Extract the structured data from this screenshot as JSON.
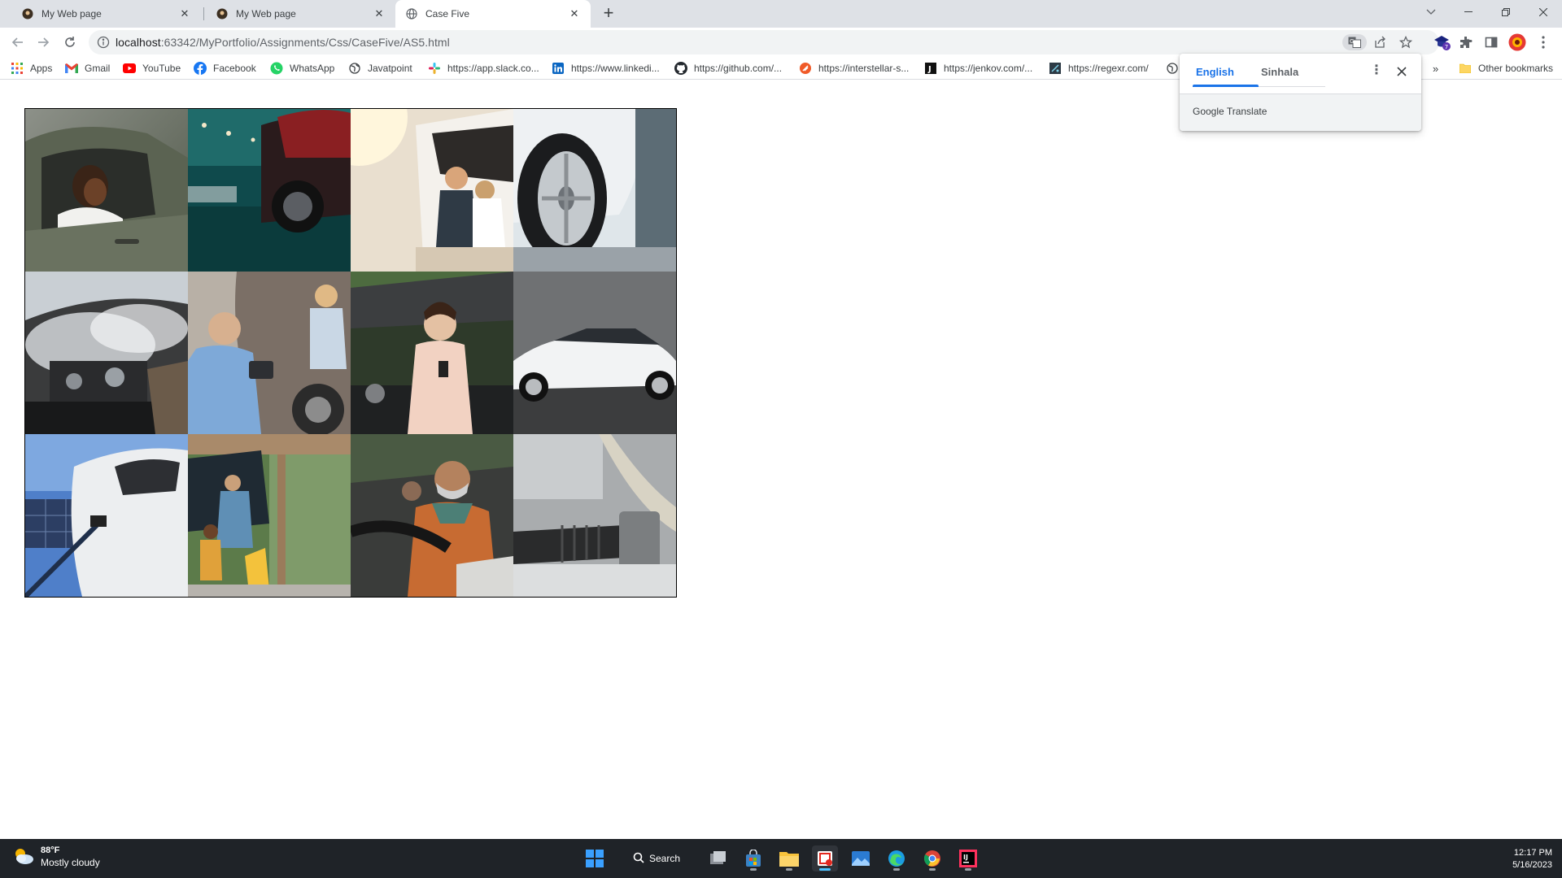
{
  "browser": {
    "tabs": [
      {
        "title": "My Web page",
        "active": false
      },
      {
        "title": "My Web page",
        "active": false
      },
      {
        "title": "Case Five",
        "active": true
      }
    ],
    "url_host": "localhost",
    "url_path": ":63342/MyPortfolio/Assignments/Css/CaseFive/AS5.html"
  },
  "bookmarks": [
    {
      "label": "Apps",
      "icon": "apps-grid-icon"
    },
    {
      "label": "Gmail",
      "icon": "gmail-icon"
    },
    {
      "label": "YouTube",
      "icon": "youtube-icon"
    },
    {
      "label": "Facebook",
      "icon": "facebook-icon"
    },
    {
      "label": "WhatsApp",
      "icon": "whatsapp-icon"
    },
    {
      "label": "Javatpoint",
      "icon": "globe-icon"
    },
    {
      "label": "https://app.slack.co...",
      "icon": "slack-icon"
    },
    {
      "label": "https://www.linkedi...",
      "icon": "linkedin-icon"
    },
    {
      "label": "https://github.com/...",
      "icon": "github-icon"
    },
    {
      "label": "https://interstellar-s...",
      "icon": "interstellar-icon"
    },
    {
      "label": "https://jenkov.com/...",
      "icon": "jenkov-icon"
    },
    {
      "label": "https://regexr.com/",
      "icon": "regexr-icon"
    }
  ],
  "other_bookmarks": "Other bookmarks",
  "translate": {
    "lang_source": "English",
    "lang_target": "Sinhala",
    "footer": "Google Translate"
  },
  "gallery": [
    "woman-driving-car-photo",
    "parked-cars-garage-photo",
    "family-in-car-trunk-photo",
    "car-wheel-closeup-photo",
    "smoking-engine-photo",
    "man-inspecting-car-damage-photo",
    "woman-stressed-open-hood-photo",
    "white-sedan-photo",
    "electric-car-charging-photo",
    "family-loading-car-photo",
    "senior-man-driving-photo",
    "car-underbody-parts-photo"
  ],
  "taskbar": {
    "weather_temp": "88°F",
    "weather_cond": "Mostly cloudy",
    "search_label": "Search",
    "time": "12:17 PM",
    "date": "5/16/2023"
  }
}
